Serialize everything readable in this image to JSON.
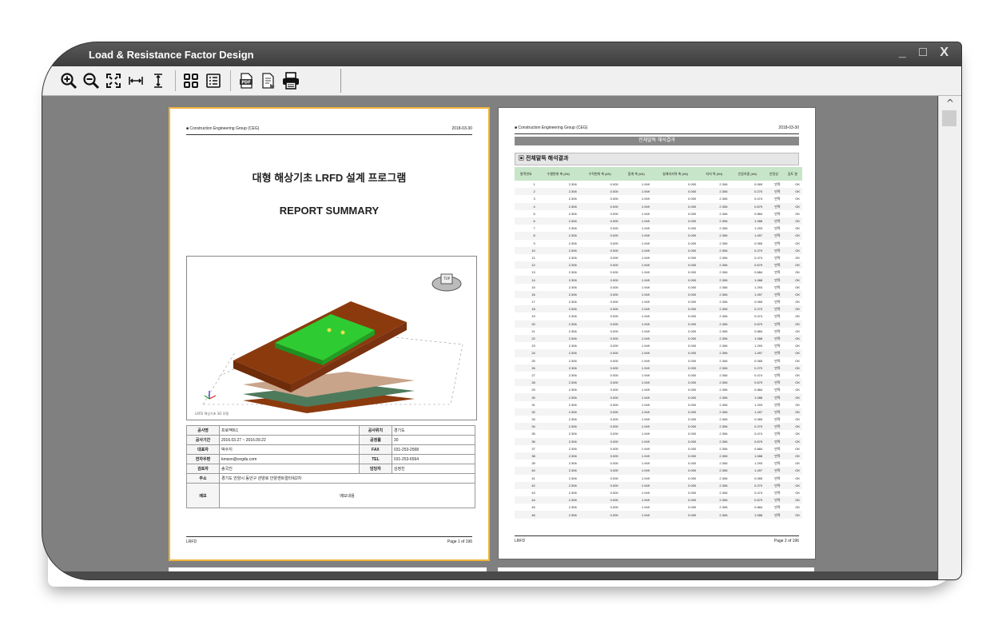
{
  "window": {
    "title": "Load & Resistance Factor Design",
    "controls": [
      "_",
      "□",
      "X"
    ]
  },
  "toolbar": {
    "icons": [
      "zoom-in-icon",
      "zoom-out-icon",
      "fit-page-icon",
      "fit-width-icon",
      "fit-height-icon",
      "thumbnails-icon",
      "outline-icon",
      "pdf-export-icon",
      "export-icon",
      "print-icon"
    ]
  },
  "page1": {
    "header_left": "■ Construction Engineering Group (CEG)",
    "header_right": "2018-03-30",
    "title": "대형 해상기초 LRFD 설계 프로그램",
    "subtitle": "REPORT SUMMARY",
    "model_caption": "LRFD 해상기초 3D 모델",
    "info": {
      "project_name_label": "공사명",
      "project_name": "프로젝트1",
      "location_label": "공사위치",
      "location": "경기도",
      "period_label": "공사기간",
      "period": "2016.03.27 ~ 2016.09.22",
      "count_label": "공정률",
      "count": "30",
      "manager_label": "대표자",
      "manager": "박수지",
      "fax_label": "FAX",
      "fax": "031-253-2568",
      "email_label": "전자우편",
      "email": "kmson@cegdu.com",
      "tel_label": "TEL",
      "tel": "031-253-6564",
      "reviewer_label": "검토자",
      "reviewer": "송국진",
      "checker_label": "담당자",
      "checker": "김정진",
      "address_label": "주소",
      "address": "경기도 안양시 동안구 관양로 안양센트럴타워2차",
      "memo_label": "메모",
      "memo": "메모내용"
    },
    "footer_left": "LRFD",
    "footer_right": "Page 1 of 196"
  },
  "page2": {
    "header_left": "■ Construction Engineering Group (CEG)",
    "header_right": "2018-03-30",
    "banner": "전체말뚝 해석결과",
    "section_title": "▣ 전체말뚝 해석결과",
    "columns": [
      "말뚝번호",
      "수평변위 축 (kN)",
      "수직변위 축 (kN)",
      "합계 축 (kN)",
      "설계지지력 축 (kN)",
      "지지 력 (kN)",
      "인장하중 (kN)",
      "안정성",
      "검토 결"
    ],
    "row_count": 46,
    "base_values": [
      "2.306",
      "0.000",
      "1.949",
      "0.000",
      "2.306"
    ],
    "ratio_cycle": [
      "0.065",
      "0.270",
      "0.474",
      "0.679",
      "0.884",
      "1.088",
      "1.293",
      "1.497"
    ],
    "status_text": "만족",
    "ok_text": "OK",
    "footer_left": "LRFD",
    "footer_right": "Page 2 of 196"
  },
  "colors": {
    "accent_border": "#f0b43a",
    "table_header": "#c7e5c8",
    "slab_top": "#2ecc32",
    "slab_brown": "#8b3a0e",
    "slab_tan": "#c8a48a",
    "slab_green": "#4e7a5c"
  }
}
